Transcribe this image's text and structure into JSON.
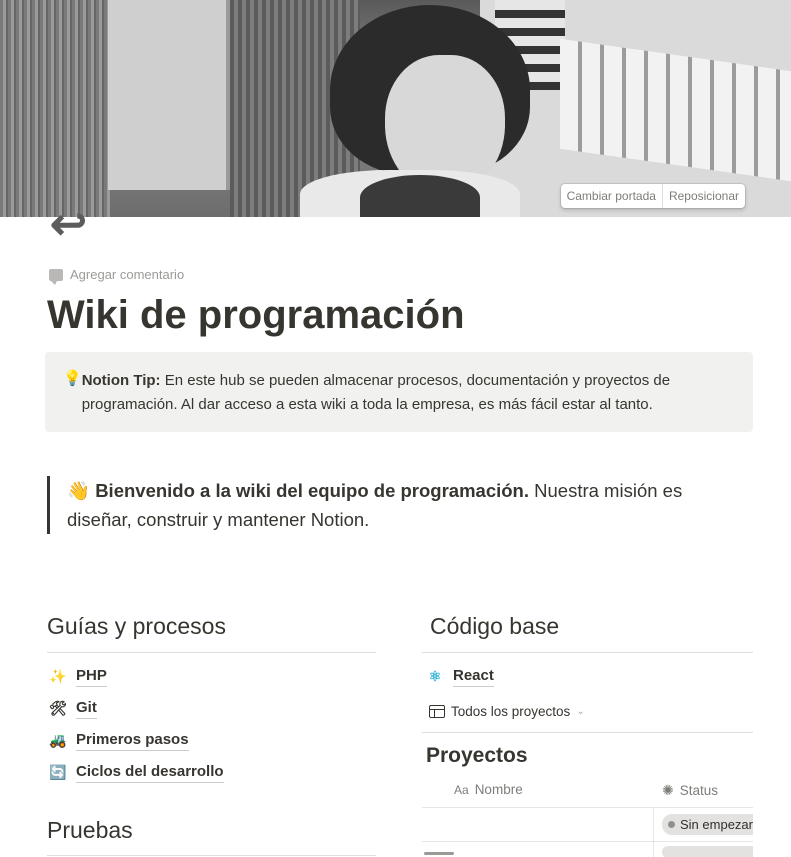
{
  "cover": {
    "change_label": "Cambiar portada",
    "reposition_label": "Reposicionar"
  },
  "page": {
    "icon": "↩",
    "add_comment": "Agregar comentario",
    "title": "Wiki de programación"
  },
  "callout": {
    "icon": "💡",
    "bold": "Notion Tip:",
    "text": " En este hub se pueden almacenar procesos, documentación y proyectos de programación. Al dar acceso a esta wiki a toda la empresa, es más fácil estar al tanto."
  },
  "quote": {
    "emoji": "👋",
    "bold": "Bienvenido a la wiki del equipo de programación.",
    "text": " Nuestra misión es diseñar, construir y mantener Notion."
  },
  "guides": {
    "heading": "Guías y procesos",
    "items": [
      {
        "icon": "✨",
        "label": "PHP"
      },
      {
        "icon": "🛠",
        "label": "Git"
      },
      {
        "icon": "🚜",
        "label": "Primeros pasos"
      },
      {
        "icon": "🔄",
        "label": "Ciclos del desarrollo"
      }
    ]
  },
  "tests": {
    "heading": "Pruebas"
  },
  "codebase": {
    "heading": "Código base",
    "items": [
      {
        "icon": "⚛",
        "label": "React"
      }
    ],
    "view_label": "Todos los proyectos",
    "db_title": "Proyectos",
    "columns": [
      {
        "icon": "Aa",
        "label": "Nombre"
      },
      {
        "icon": "✺",
        "label": "Status"
      }
    ],
    "rows": [
      {
        "name": "",
        "status": "Sin empezar"
      }
    ]
  },
  "colors": {
    "text": "#37352f",
    "callout_bg": "#f1f1ef",
    "status_pill": "#e3e2e0"
  }
}
